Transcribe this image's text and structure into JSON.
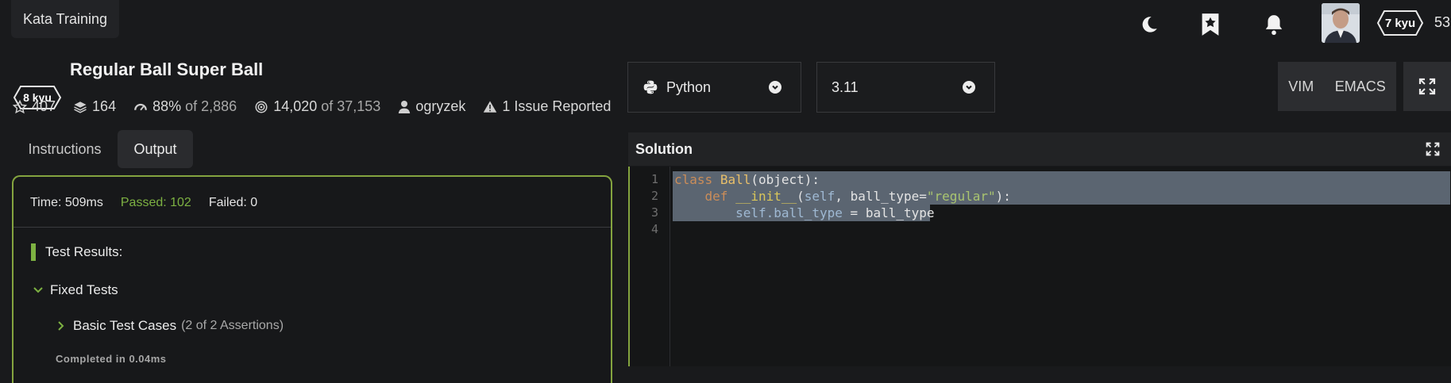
{
  "app": {
    "brand": "Kata Training",
    "user_honor": "53",
    "user_rank": "7 kyu"
  },
  "kata": {
    "rank": "8 kyu",
    "title": "Regular Ball Super Ball",
    "stars": "407",
    "collections": "164",
    "satisfaction": "88%",
    "satisfaction_suffix": "of 2,886",
    "completed": "14,020",
    "completed_suffix": "of 37,153",
    "author": "ogryzek",
    "issues": "1 Issue Reported"
  },
  "tabs": [
    {
      "label": "Instructions"
    },
    {
      "label": "Output"
    }
  ],
  "output": {
    "time": "Time: 509ms",
    "passed": "Passed: 102",
    "failed": "Failed: 0",
    "results_heading": "Test Results:",
    "group": "Fixed Tests",
    "case": "Basic Test Cases",
    "assertions": "(2 of 2 Assertions)",
    "completed": "Completed in 0.04ms"
  },
  "editor_controls": {
    "language": "Python",
    "version": "3.11",
    "vim": "VIM",
    "emacs": "EMACS"
  },
  "solution": {
    "title": "Solution",
    "line_numbers": [
      "1",
      "2",
      "3",
      "4"
    ],
    "line1": {
      "kw": "class",
      "name": "Ball",
      "rest": "(object):"
    },
    "line2": {
      "indent": "    ",
      "kw": "def",
      "name": "__init__",
      "open": "(",
      "self": "self",
      "mid": ", ball_type=",
      "str": "\"regular\"",
      "close": "):"
    },
    "line3": {
      "indent": "        ",
      "self": "self",
      "attr": ".ball_type",
      "rest": " = ball_type"
    }
  },
  "colors": {
    "accent": "#84a43f",
    "passed": "#7db142",
    "selection": "#5b6571"
  }
}
